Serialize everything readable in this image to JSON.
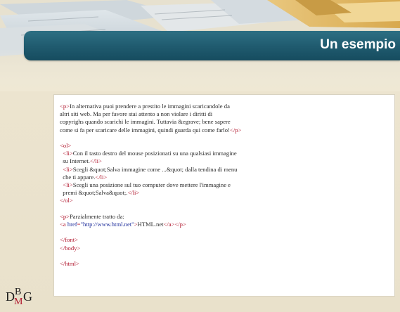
{
  "slide": {
    "title": "Un esempio"
  },
  "logo": {
    "text_d": "D",
    "text_b": "B",
    "text_m": "M",
    "text_g": "G",
    "color_dark": "#1a1a1a",
    "color_accent": "#b0152c"
  },
  "code": {
    "lines": [
      [
        [
          "tag",
          "<p>"
        ],
        [
          "txt",
          "In alternativa puoi prendere a prestito le immagini scaricandole da"
        ]
      ],
      [
        [
          "txt",
          "altri siti web. Ma per favore stai attento a non violare i diritti di"
        ]
      ],
      [
        [
          "txt",
          "copyrighs quando scarichi le immagini. Tuttavia &egrave; bene sapere"
        ]
      ],
      [
        [
          "txt",
          "come si fa per scaricare delle immagini, quindi guarda qui come farlo!"
        ],
        [
          "tag",
          "</p>"
        ]
      ],
      [],
      [
        [
          "tag",
          "<ol>"
        ]
      ],
      [
        [
          "txt",
          "  "
        ],
        [
          "tag",
          "<li>"
        ],
        [
          "txt",
          "Con il tasto destro del mouse posizionati su una qualsiasi immagine"
        ]
      ],
      [
        [
          "txt",
          "  su Internet."
        ],
        [
          "tag",
          "</li>"
        ]
      ],
      [
        [
          "txt",
          "  "
        ],
        [
          "tag",
          "<li>"
        ],
        [
          "txt",
          "Scegli &quot;Salva immagine come ...&quot; dalla tendina di menu"
        ]
      ],
      [
        [
          "txt",
          "  che ti appare."
        ],
        [
          "tag",
          "</li>"
        ]
      ],
      [
        [
          "txt",
          "  "
        ],
        [
          "tag",
          "<li>"
        ],
        [
          "txt",
          "Scegli una posizione sul tuo computer dove mettere l'immagine e"
        ]
      ],
      [
        [
          "txt",
          "  premi &quot;Salva&quot;."
        ],
        [
          "tag",
          "</li>"
        ]
      ],
      [
        [
          "tag",
          "</ol>"
        ]
      ],
      [],
      [
        [
          "tag",
          "<p>"
        ],
        [
          "txt",
          "Parzialmente tratto da:"
        ]
      ],
      [
        [
          "tag",
          "<a "
        ],
        [
          "attr",
          "href"
        ],
        [
          "tag",
          "="
        ],
        [
          "str",
          "\"http://www.html.net\""
        ],
        [
          "tag",
          ">"
        ],
        [
          "txt",
          "HTML.net"
        ],
        [
          "tag",
          "</a></p>"
        ]
      ],
      [],
      [
        [
          "tag",
          "</font>"
        ]
      ],
      [
        [
          "tag",
          "</body>"
        ]
      ],
      [],
      [
        [
          "tag",
          "</html>"
        ]
      ]
    ]
  }
}
